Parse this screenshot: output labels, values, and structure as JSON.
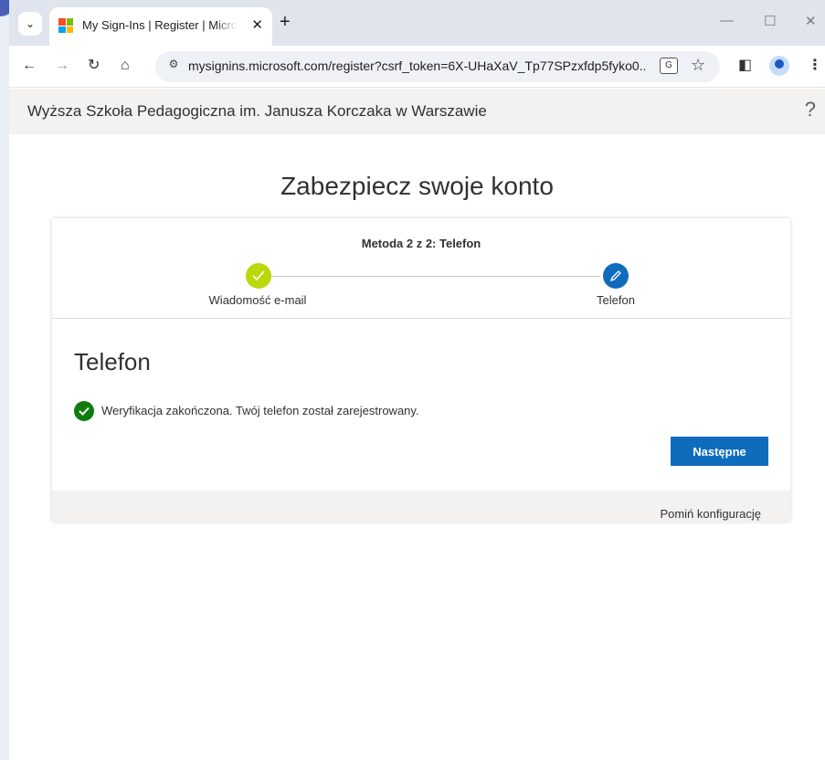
{
  "browser": {
    "tab": {
      "title": "My Sign-Ins | Register | Microsoft",
      "favicon": "microsoft-logo-icon",
      "close_glyph": "✕"
    },
    "new_tab_glyph": "+",
    "tab_search_glyph": "⌄",
    "window_controls": {
      "minimize": "—",
      "maximize": "☐",
      "close": "✕"
    },
    "toolbar": {
      "back_glyph": "←",
      "forward_glyph": "→",
      "reload_glyph": "↻",
      "home_glyph": "⌂",
      "site_info_glyph": "⚙",
      "url": "mysignins.microsoft.com/register?csrf_token=6X-UHaXaV_Tp77SPzxfdp5fyko0...",
      "translate_glyph": "G",
      "bookmark_glyph": "☆",
      "sidepanel_glyph": "◧",
      "menu_glyph": "⋮"
    }
  },
  "header": {
    "org_name": "Wyższa Szkoła Pedagogiczna im. Janusza Korczaka w Warszawie",
    "help_glyph": "?"
  },
  "main": {
    "page_title": "Zabezpiecz swoje konto",
    "progress": {
      "title": "Metoda 2 z 2: Telefon",
      "steps": [
        {
          "label": "Wiadomość e-mail",
          "state": "completed"
        },
        {
          "label": "Telefon",
          "state": "current"
        }
      ]
    },
    "section_title": "Telefon",
    "success_message": "Weryfikacja zakończona. Twój telefon został zarejestrowany.",
    "next_button": "Następne",
    "skip_link": "Pomiń konfigurację"
  },
  "colors": {
    "accent": "#0f6cbd",
    "step_done": "#bad80a",
    "success": "#107c10"
  }
}
